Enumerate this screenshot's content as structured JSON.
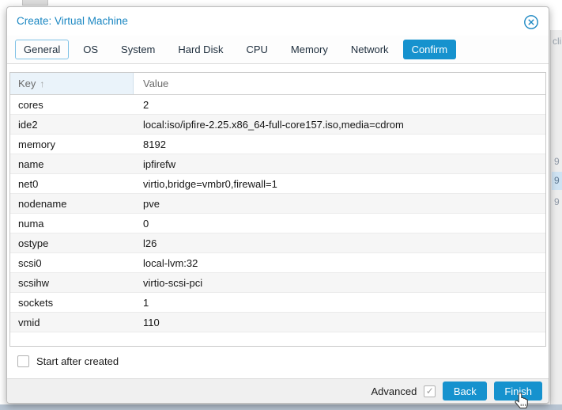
{
  "window": {
    "title": "Create: Virtual Machine",
    "close_icon": "circle-x"
  },
  "tabs": [
    {
      "label": "General",
      "state": "focused"
    },
    {
      "label": "OS",
      "state": "normal"
    },
    {
      "label": "System",
      "state": "normal"
    },
    {
      "label": "Hard Disk",
      "state": "normal"
    },
    {
      "label": "CPU",
      "state": "normal"
    },
    {
      "label": "Memory",
      "state": "normal"
    },
    {
      "label": "Network",
      "state": "normal"
    },
    {
      "label": "Confirm",
      "state": "active"
    }
  ],
  "table": {
    "columns": {
      "key": "Key",
      "value": "Value"
    },
    "sort": {
      "column": "Key",
      "direction": "asc",
      "icon": "↑"
    },
    "rows": [
      {
        "key": "cores",
        "value": "2"
      },
      {
        "key": "ide2",
        "value": "local:iso/ipfire-2.25.x86_64-full-core157.iso,media=cdrom"
      },
      {
        "key": "memory",
        "value": "8192"
      },
      {
        "key": "name",
        "value": "ipfirefw"
      },
      {
        "key": "net0",
        "value": "virtio,bridge=vmbr0,firewall=1"
      },
      {
        "key": "nodename",
        "value": "pve"
      },
      {
        "key": "numa",
        "value": "0"
      },
      {
        "key": "ostype",
        "value": "l26"
      },
      {
        "key": "scsi0",
        "value": "local-lvm:32"
      },
      {
        "key": "scsihw",
        "value": "virtio-scsi-pci"
      },
      {
        "key": "sockets",
        "value": "1"
      },
      {
        "key": "vmid",
        "value": "110"
      }
    ]
  },
  "start_after_created": {
    "label": "Start after created",
    "checked": false
  },
  "footer": {
    "advanced_label": "Advanced",
    "advanced_checked": true,
    "advanced_check_glyph": "✓",
    "back_label": "Back",
    "finish_label": "Finish"
  },
  "background": {
    "fragments": {
      "top_text": "cli",
      "row1": "9",
      "row2": "9",
      "row3": "9"
    }
  },
  "colors": {
    "accent": "#1692ce",
    "title": "#1b87c2",
    "key_header_bg": "#eaf3fa",
    "row_stripe": "#f6f6f6",
    "footer_bg": "#f0f0f0",
    "bottom_strip": "#b7c4d2",
    "highlight_band": "#cfe3f3"
  }
}
